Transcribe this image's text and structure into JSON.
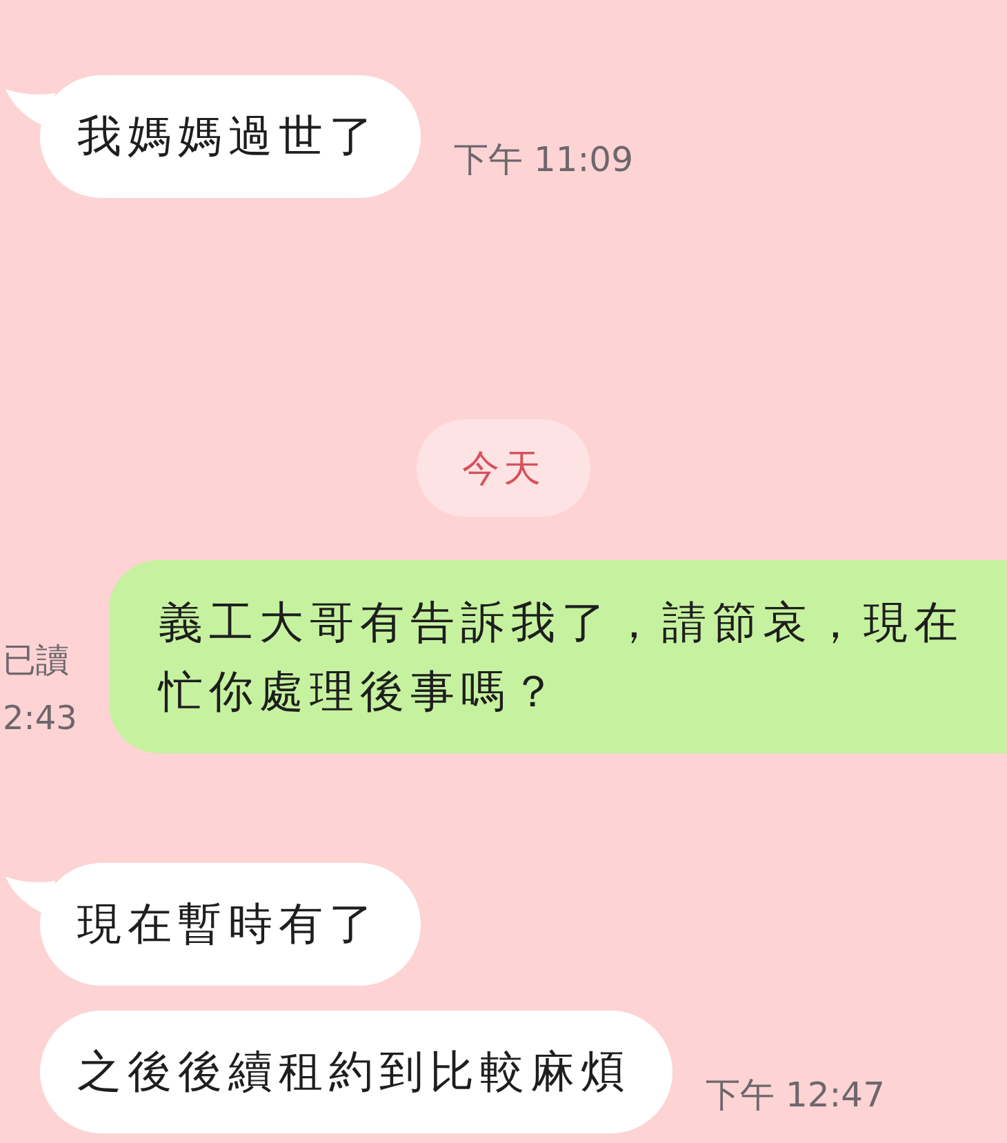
{
  "messages": [
    {
      "kind": "incoming",
      "text": "我媽媽過世了",
      "tail": true,
      "time": "下午 11:09"
    },
    {
      "kind": "date",
      "text": "今天"
    },
    {
      "kind": "outgoing",
      "text": "義工大哥有告訴我了，請節哀，現在忙你處理後事嗎？",
      "read": "已讀",
      "time": "2:43"
    },
    {
      "kind": "incoming",
      "text": "現在暫時有了",
      "tail": true
    },
    {
      "kind": "incoming",
      "text": "之後後續租約到比較麻煩",
      "tail": false,
      "time": "下午 12:47"
    }
  ]
}
